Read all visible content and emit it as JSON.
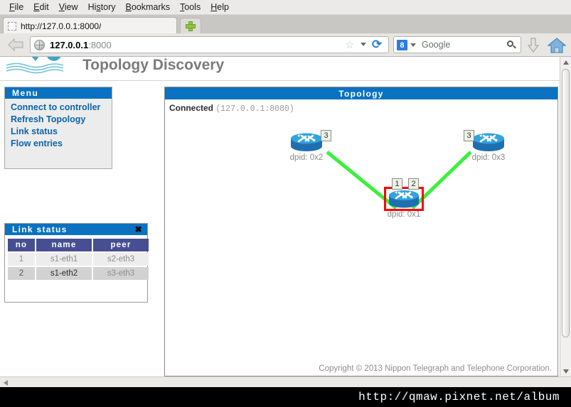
{
  "browser": {
    "menubar": [
      {
        "label": "File",
        "accel": "F"
      },
      {
        "label": "Edit",
        "accel": "E"
      },
      {
        "label": "View",
        "accel": "V"
      },
      {
        "label": "History",
        "accel": "s"
      },
      {
        "label": "Bookmarks",
        "accel": "B"
      },
      {
        "label": "Tools",
        "accel": "T"
      },
      {
        "label": "Help",
        "accel": "H"
      }
    ],
    "tab": {
      "title": "http://127.0.0.1:8000/"
    },
    "newtab_label": "+",
    "address": {
      "host": "127.0.0.1",
      "rest": ":8000",
      "full": "127.0.0.1:8000"
    },
    "search": {
      "engine": "Google",
      "logo_letter": "8"
    },
    "icons": {
      "back": "back-arrow-icon",
      "globe": "globe-icon",
      "star": "☆",
      "reload": "⟳",
      "download": "download-arrow-icon",
      "home": "home-icon",
      "magnifier": "search-icon"
    }
  },
  "page": {
    "logo_alt": "ryu-logo",
    "title": "Topology Discovery",
    "copyright": "Copyright © 2013 Nippon Telegraph and Telephone Corporation."
  },
  "menu_panel": {
    "title": "Menu",
    "items": [
      {
        "label": "Connect to controller"
      },
      {
        "label": "Refresh Topology"
      },
      {
        "label": "Link status"
      },
      {
        "label": "Flow entries"
      }
    ]
  },
  "link_status_panel": {
    "title": "Link status",
    "close_label": "✖",
    "columns": [
      "no",
      "name",
      "peer"
    ],
    "rows": [
      {
        "no": "1",
        "name": "s1-eth1",
        "peer": "s2-eth3"
      },
      {
        "no": "2",
        "name": "s1-eth2",
        "peer": "s3-eth3"
      }
    ]
  },
  "topology_panel": {
    "title": "Topology",
    "status_label": "Connected",
    "status_address": "(127.0.0.1:8080)",
    "nodes": [
      {
        "id": "s2",
        "dpid": "dpid: 0x2",
        "ports": [
          "3"
        ],
        "selected": false
      },
      {
        "id": "s3",
        "dpid": "dpid: 0x3",
        "ports": [
          "3"
        ],
        "selected": false
      },
      {
        "id": "s1",
        "dpid": "dpid: 0x1",
        "ports": [
          "1",
          "2"
        ],
        "selected": true
      }
    ],
    "links": [
      {
        "from": "s2",
        "from_port": "3",
        "to": "s1",
        "to_port": "1"
      },
      {
        "from": "s3",
        "from_port": "3",
        "to": "s1",
        "to_port": "2"
      }
    ],
    "link_color": "#3cf03c",
    "selection_color": "#ff0000"
  },
  "watermark": {
    "text": "http://qmaw.pixnet.net/album"
  }
}
